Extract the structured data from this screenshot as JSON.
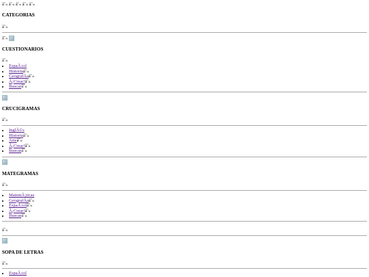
{
  "top_junk": "âˆ« âˆ« âˆ« âˆ« âˆ«",
  "junk": "âˆ«",
  "sections": [
    {
      "title": "CATEGORIAS"
    },
    {
      "title": "CUESTIONARIOS",
      "items": [
        "EspaÃ±ol",
        "Historia",
        "GeografÃ­a",
        "Â¡Crear!",
        "Buscar"
      ]
    },
    {
      "title": "CRUCIGRAMAS",
      "items": [
        "InglÃ©s",
        "Historia",
        "Arte",
        "Â¡Crear!",
        "Buscar"
      ]
    },
    {
      "title": "MATEGRAMAS",
      "items": [
        "MatemÃ¡ticas",
        "GeografÃ­a",
        "EspaÃ±ol",
        "Â¡Crear!",
        "Buscar"
      ]
    },
    {
      "title": "SOPA DE LETRAS",
      "items": [
        "EspaÃ±ol"
      ]
    }
  ]
}
